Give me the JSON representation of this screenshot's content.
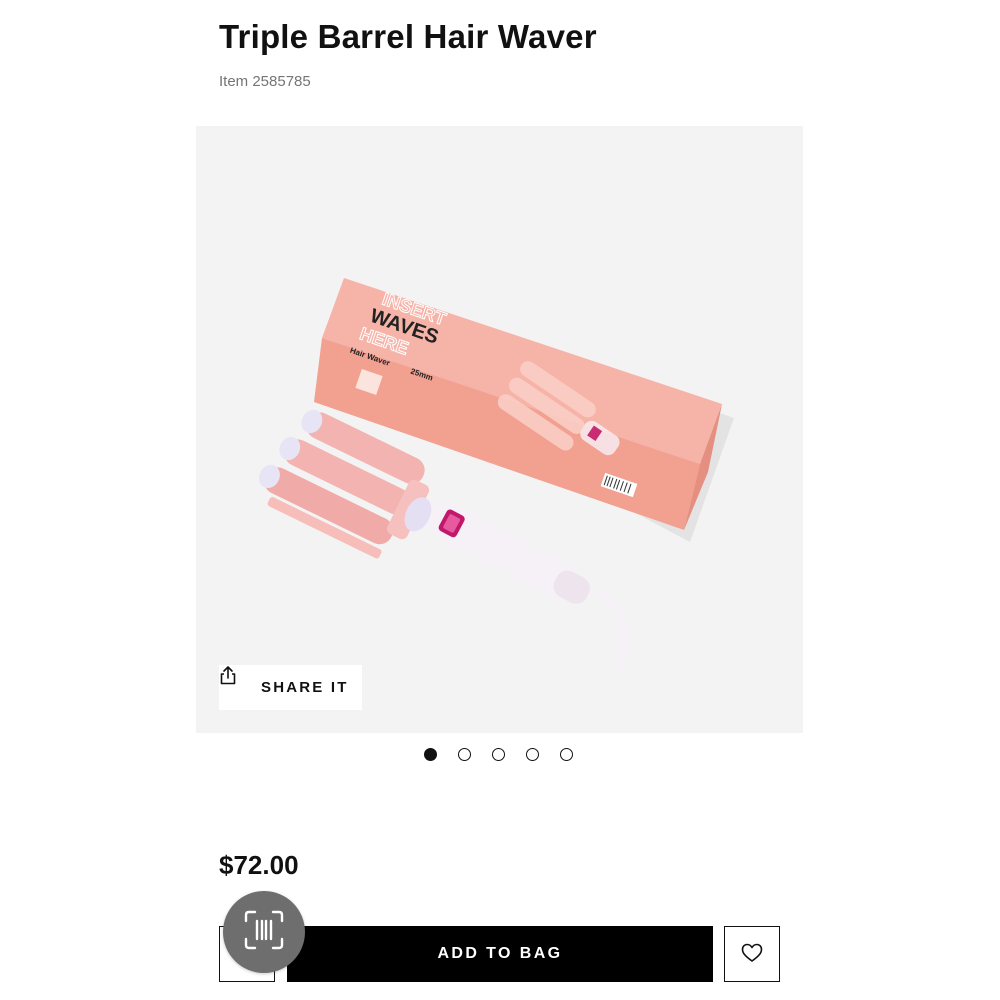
{
  "product": {
    "title": "Triple Barrel Hair Waver",
    "item_number": "Item 2585785"
  },
  "gallery": {
    "share_label": "SHARE IT",
    "share_icon": "share-icon",
    "total_images": 5,
    "active_index": 0,
    "box_text": {
      "brand_outline_top": "INSERT",
      "brand_main": "WAVES",
      "brand_outline_bottom": "HERE",
      "product_line": "Hair Waver",
      "size": "25mm"
    },
    "colors": {
      "background": "#f3f3f3",
      "box_pink": "#f4a99c",
      "barrel_pink": "#f2b3b1",
      "handle_white": "#f6f1f6",
      "display_magenta": "#c2186b"
    }
  },
  "purchase": {
    "price": "$72.00",
    "add_to_bag_label": "ADD TO BAG",
    "wishlist_icon": "heart-icon",
    "scan_icon": "barcode-scan-icon"
  }
}
